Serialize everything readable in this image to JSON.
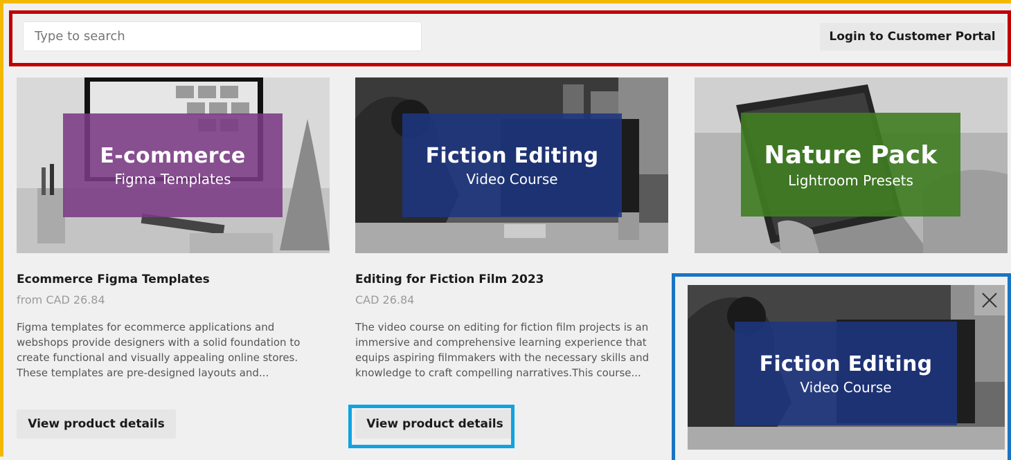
{
  "search": {
    "placeholder": "Type to search"
  },
  "header": {
    "login_label": "Login to Customer Portal"
  },
  "products": [
    {
      "thumb_title": "E-commerce",
      "thumb_subtitle": "Figma Templates",
      "thumb_color": "#7a3a84",
      "name": "Ecommerce Figma Templates",
      "price": "from CAD 26.84",
      "description": "Figma templates for ecommerce applications and webshops provide designers with a solid foundation to create functional and visually appealing online stores. These templates are pre-designed layouts and...",
      "button_label": "View product details"
    },
    {
      "thumb_title": "Fiction Editing",
      "thumb_subtitle": "Video Course",
      "thumb_color": "#1e3580",
      "name": "Editing for Fiction Film 2023",
      "price": "CAD 26.84",
      "description": "The video course on editing for fiction film projects is an immersive and comprehensive learning experience that equips aspiring filmmakers with the necessary skills and knowledge to craft compelling narratives.This course...",
      "button_label": "View product details"
    },
    {
      "thumb_title": "Nature Pack",
      "thumb_subtitle": "Lightroom Presets",
      "thumb_color": "#3f7d22"
    }
  ],
  "popup": {
    "title": "Fiction Editing",
    "subtitle": "Video Course",
    "close_icon": "close-icon"
  },
  "colors": {
    "frame_outer": "#f3b800",
    "frame_header": "#c00000",
    "frame_button": "#10a3e0",
    "frame_popup": "#1a74c4"
  }
}
